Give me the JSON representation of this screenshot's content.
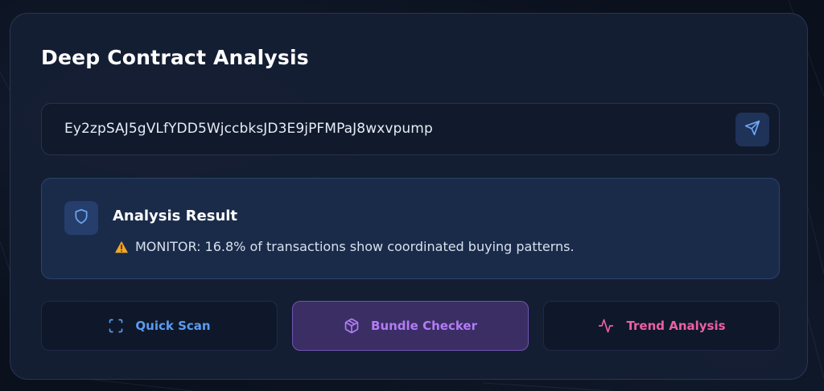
{
  "panel": {
    "title": "Deep Contract Analysis"
  },
  "address_input": {
    "value": "Ey2zpSAJ5gVLfYDD5WjccbksJD3E9jPFMPaJ8wxvpump",
    "submit_icon": "send-icon"
  },
  "result": {
    "icon": "shield-icon",
    "title": "Analysis Result",
    "status_icon": "warning-icon",
    "message": "MONITOR: 16.8% of transactions show coordinated buying patterns."
  },
  "actions": [
    {
      "label": "Quick Scan",
      "icon": "scan-icon",
      "color": "#5b9cf0"
    },
    {
      "label": "Bundle Checker",
      "icon": "package-icon",
      "color": "#b27cf4",
      "active": true
    },
    {
      "label": "Trend Analysis",
      "icon": "activity-icon",
      "color": "#ec5fa8"
    }
  ],
  "colors": {
    "background": "#0a101c",
    "panel": "#151f34",
    "result_panel": "#1a2b4a",
    "accent_blue": "#5b9cf0",
    "accent_purple": "#b27cf4",
    "accent_pink": "#ec5fa8",
    "warning": "#f5a623"
  }
}
